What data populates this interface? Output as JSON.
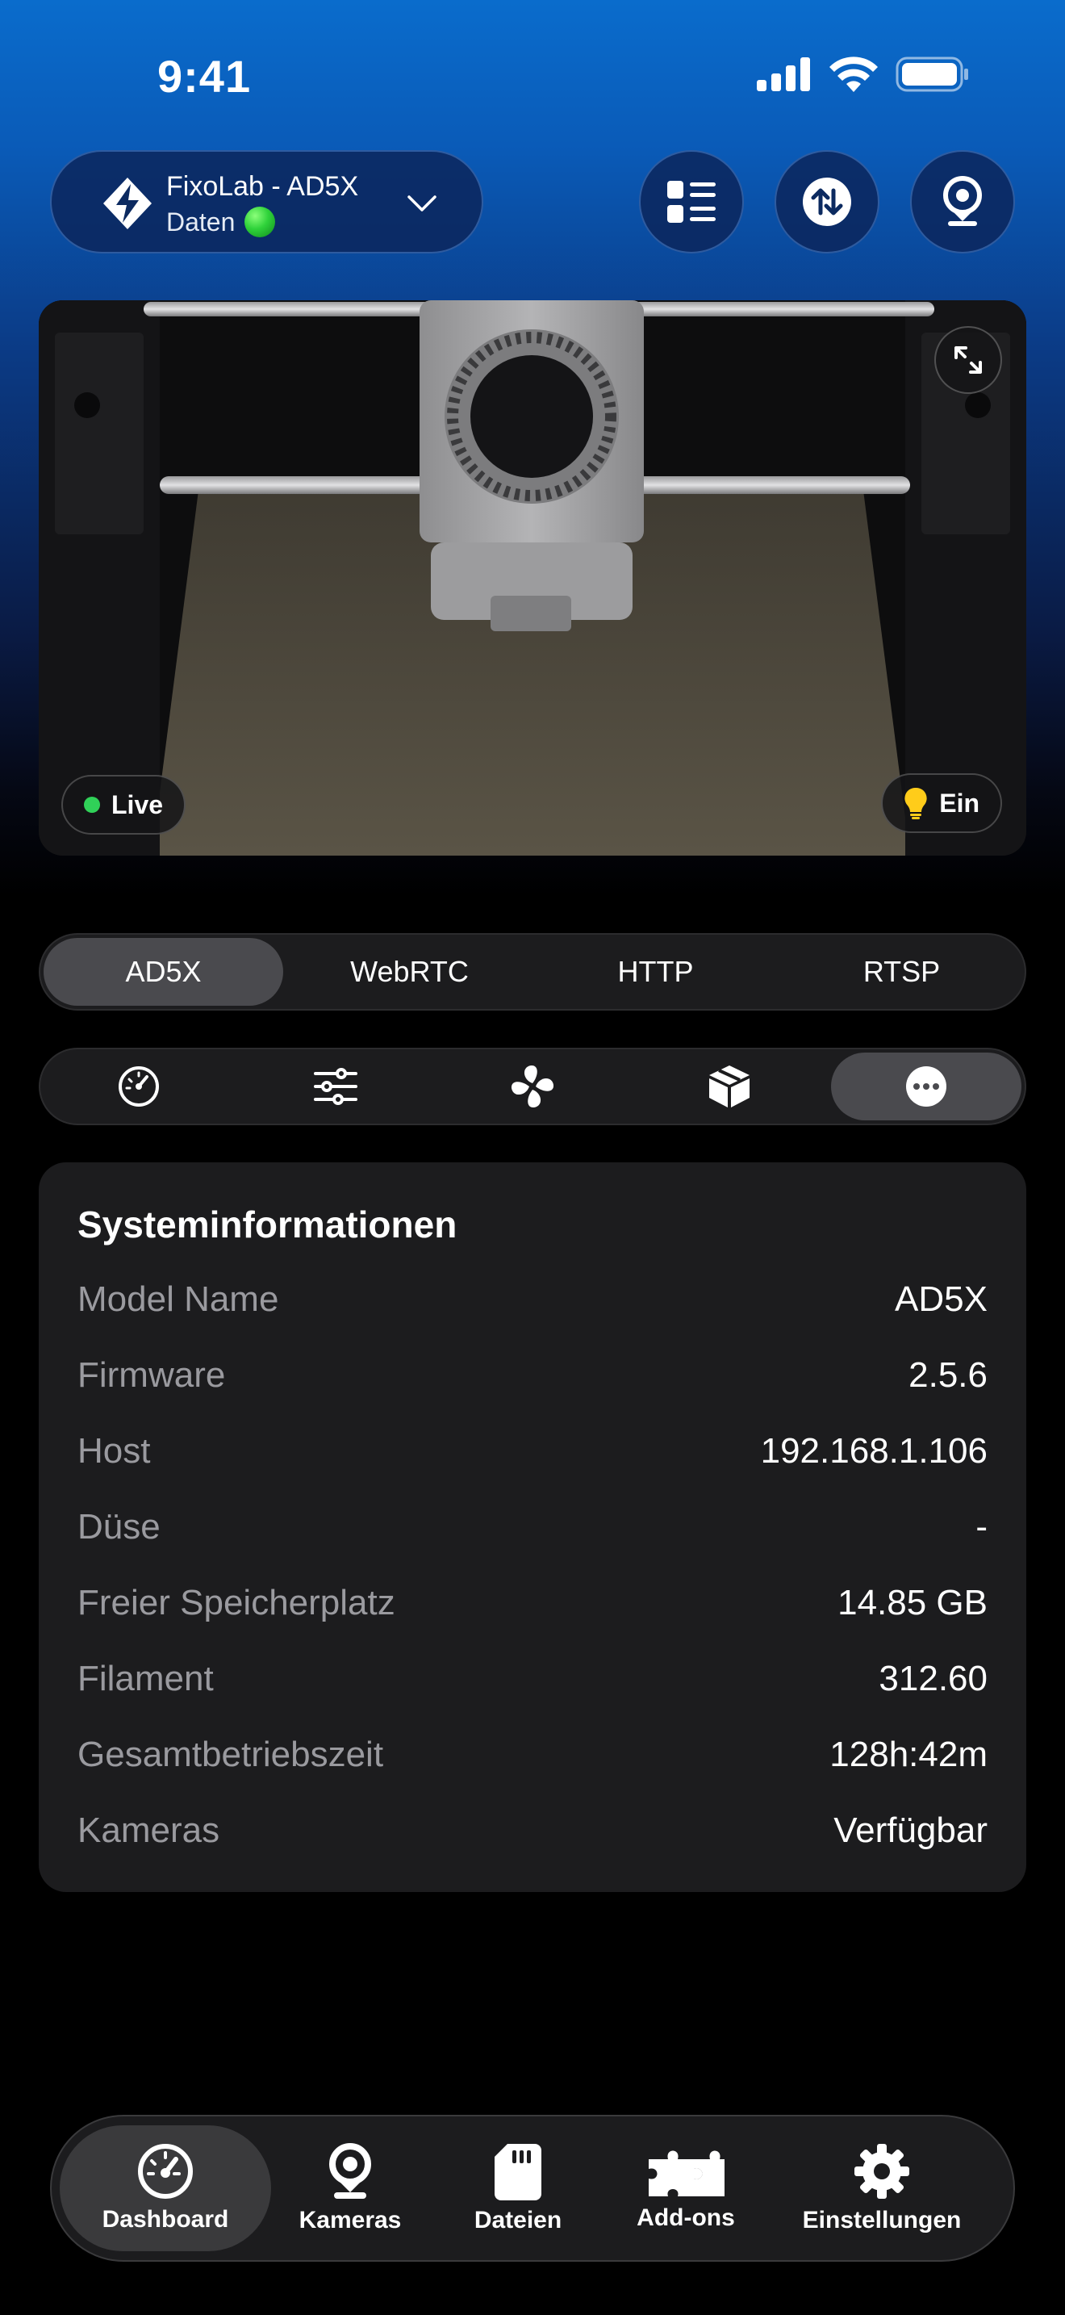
{
  "status_bar": {
    "time": "9:41"
  },
  "header": {
    "printer_name": "FixoLab - AD5X",
    "printer_status": "Daten",
    "buttons": [
      "list-icon",
      "transfer-icon",
      "webcam-icon"
    ]
  },
  "camera": {
    "live_label": "Live",
    "light_label": "Ein"
  },
  "stream_tabs": {
    "items": [
      "AD5X",
      "WebRTC",
      "HTTP",
      "RTSP"
    ],
    "active": "AD5X"
  },
  "icon_tabs": {
    "items": [
      "gauge-icon",
      "sliders-icon",
      "fan-icon",
      "box-icon",
      "more-icon"
    ],
    "active": "more-icon"
  },
  "system_info": {
    "title": "Systeminformationen",
    "rows": [
      {
        "label": "Model Name",
        "value": "AD5X"
      },
      {
        "label": "Firmware",
        "value": "2.5.6"
      },
      {
        "label": "Host",
        "value": "192.168.1.106"
      },
      {
        "label": "Düse",
        "value": "-"
      },
      {
        "label": "Freier Speicherplatz",
        "value": "14.85 GB"
      },
      {
        "label": "Filament",
        "value": "312.60"
      },
      {
        "label": "Gesamtbetriebszeit",
        "value": "128h:42m"
      },
      {
        "label": "Kameras",
        "value": "Verfügbar"
      }
    ]
  },
  "tab_bar": {
    "items": [
      {
        "label": "Dashboard",
        "icon": "gauge-icon"
      },
      {
        "label": "Kameras",
        "icon": "webcam-icon"
      },
      {
        "label": "Dateien",
        "icon": "sd-card-icon"
      },
      {
        "label": "Add-ons",
        "icon": "puzzle-icon"
      },
      {
        "label": "Einstellungen",
        "icon": "gear-icon"
      }
    ],
    "active": "Dashboard"
  },
  "colors": {
    "accent_blue": "#0a6ccc",
    "live_green": "#30d158",
    "card_bg": "#1c1c1e",
    "active_segment": "#4a4a4e"
  }
}
